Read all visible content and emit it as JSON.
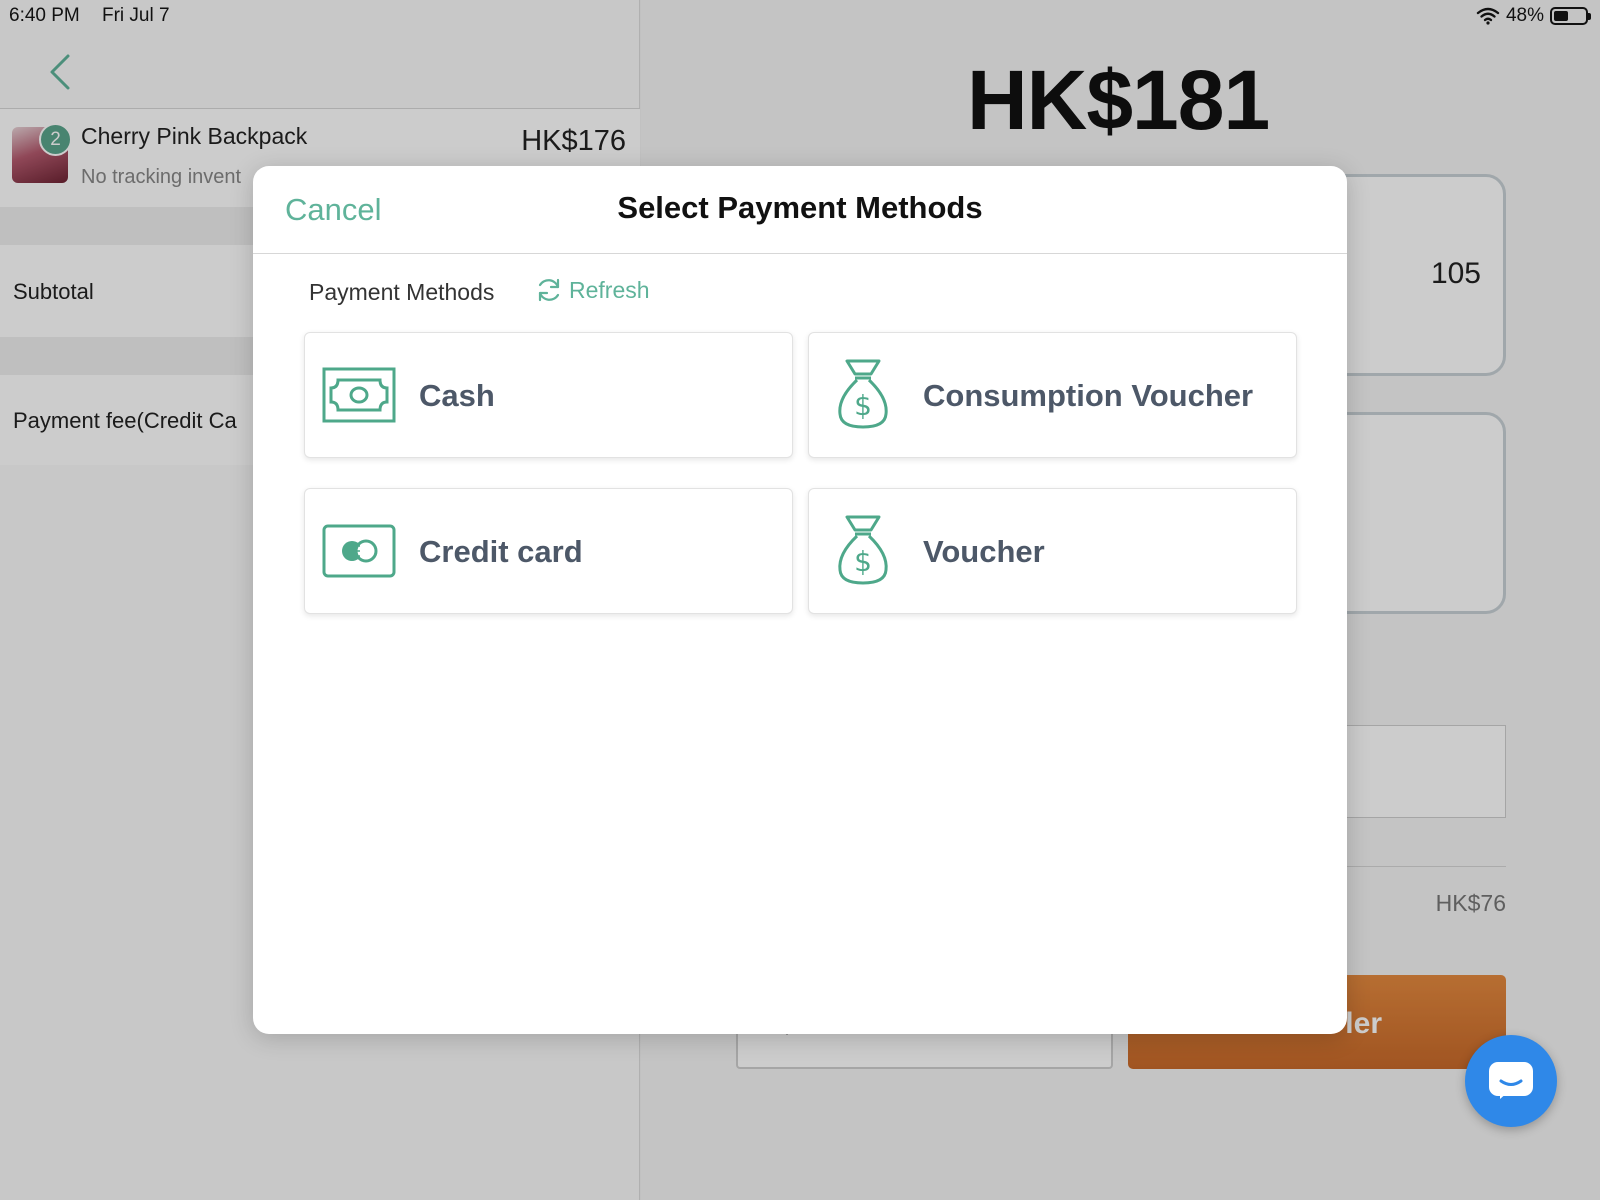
{
  "status_bar": {
    "time": "6:40 PM",
    "date": "Fri Jul 7",
    "battery": "48%",
    "battery_level": 0.48
  },
  "cart": {
    "item": {
      "name": "Cherry Pink Backpack",
      "subtitle": "No tracking invent",
      "price": "HK$176",
      "quantity": "2"
    },
    "subtotal_label": "Subtotal",
    "payment_fee_label": "Payment fee(Credit Ca"
  },
  "checkout": {
    "total": "HK$181",
    "received_value": "105",
    "fee_value": "HK$76",
    "order_button_partial": "ler"
  },
  "modal": {
    "cancel_label": "Cancel",
    "title": "Select Payment Methods",
    "section_label": "Payment Methods",
    "refresh_label": "Refresh",
    "methods": [
      {
        "label": "Cash",
        "icon": "cash-icon"
      },
      {
        "label": "Consumption Voucher",
        "icon": "money-bag-icon"
      },
      {
        "label": "Credit card",
        "icon": "credit-card-icon"
      },
      {
        "label": "Voucher",
        "icon": "money-bag-icon"
      }
    ]
  },
  "colors": {
    "accent": "#5fb39a",
    "icon_green": "#4ea88a",
    "method_text": "#4d5868",
    "order_button": "#d97a35",
    "chat_button": "#2f88e8"
  }
}
